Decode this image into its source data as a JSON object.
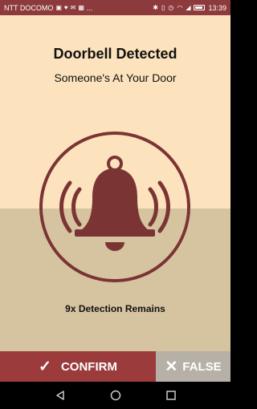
{
  "status_bar": {
    "carrier": "NTT DOCOMO",
    "time": "13:39",
    "extra": "..."
  },
  "screen": {
    "title": "Doorbell Detected",
    "subtitle": "Someone's At Your Door",
    "detections_text": "9x Detection Remains"
  },
  "actions": {
    "confirm_label": "CONFIRM",
    "false_label": "FALSE"
  },
  "colors": {
    "status_bar": "#8d3a3c",
    "background_top": "#fde3bd",
    "background_bottom": "#d6c3a0",
    "bell": "#7a3434",
    "confirm_button": "#9b3b3b",
    "false_button": "#b6b0a6"
  },
  "icons": {
    "bell": "bell-icon",
    "confirm": "check-icon",
    "false": "close-icon"
  }
}
